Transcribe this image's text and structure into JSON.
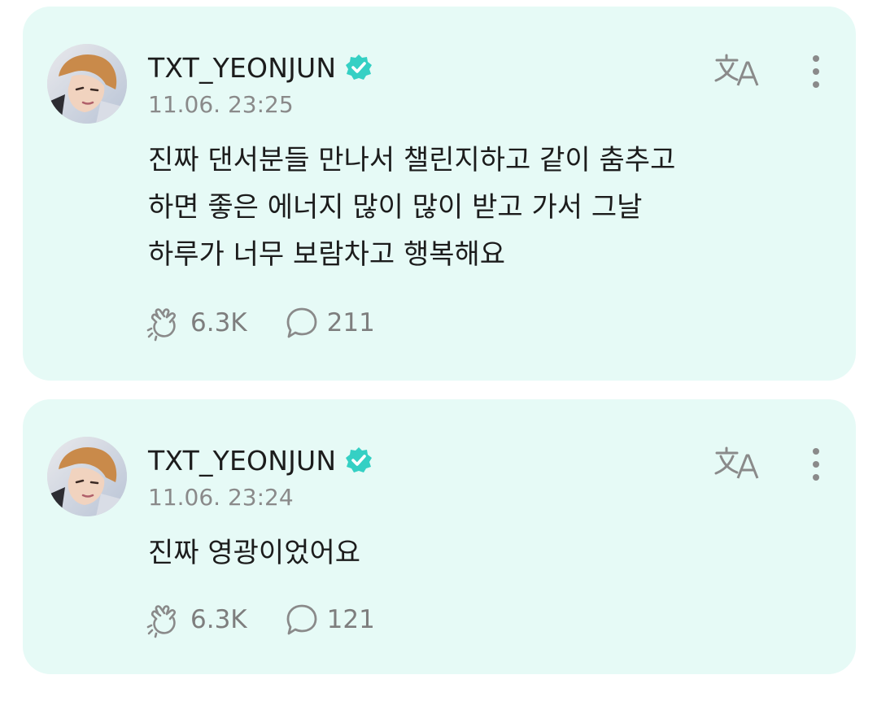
{
  "posts": [
    {
      "username": "TXT_YEONJUN",
      "timestamp": "11.06. 23:25",
      "body_lines": [
        "진짜 댄서분들 만나서 챌린지하고 같이 춤추고",
        "하면 좋은 에너지 많이 많이 받고 가서 그날",
        "하루가 너무 보람차고 행복해요"
      ],
      "likes": "6.3K",
      "comments": "211"
    },
    {
      "username": "TXT_YEONJUN",
      "timestamp": "11.06. 23:24",
      "body_lines": [
        "진짜 영광이었어요"
      ],
      "likes": "6.3K",
      "comments": "121"
    }
  ],
  "icons": {
    "verified": "verified-badge-icon",
    "translate": "translate-icon",
    "more": "more-vertical-icon",
    "like": "cheer-hand-icon",
    "comment": "comment-bubble-icon"
  },
  "colors": {
    "card_background": "#e6faf6",
    "verified_badge": "#35d0c4",
    "text_primary": "#1c1c1c",
    "text_secondary": "#8a8a8a",
    "icon_gray": "#8a8a8a"
  }
}
